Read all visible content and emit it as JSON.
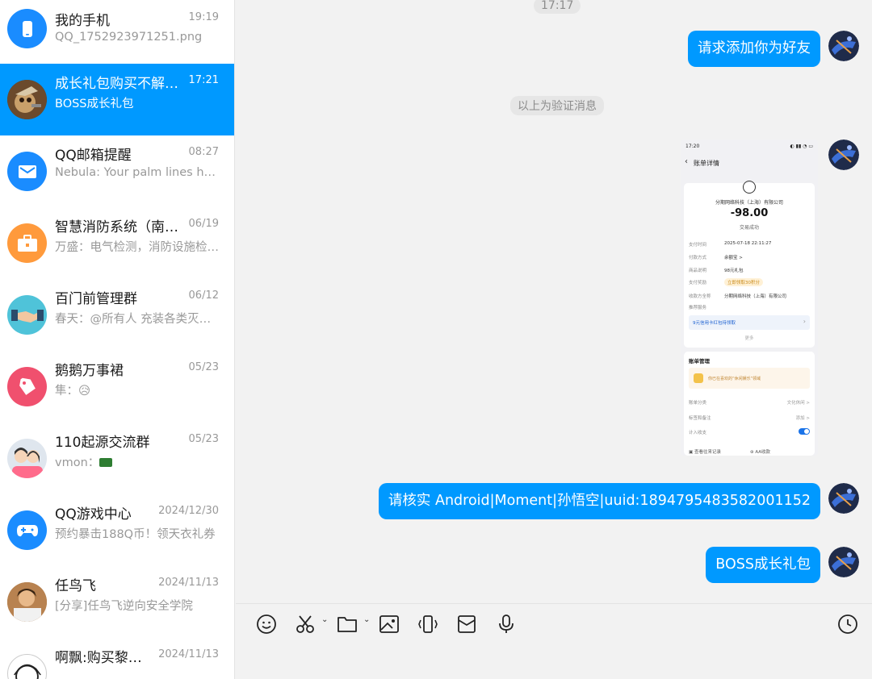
{
  "conversations": [
    {
      "name": "我的手机",
      "time": "19:19",
      "preview": "QQ_1752923971251.png",
      "icon": "phone-icon",
      "active": false
    },
    {
      "name": "成长礼包购买不解…",
      "time": "17:21",
      "preview": "BOSS成长礼包",
      "icon": "cartoon-avatar",
      "active": true
    },
    {
      "name": "QQ邮箱提醒",
      "time": "08:27",
      "preview": "Nebula: Your palm lines ha…",
      "icon": "mail-icon",
      "active": false
    },
    {
      "name": "智慧消防系统（南…",
      "time": "06/19",
      "preview": "万盛：电气检测，消防设施检…",
      "icon": "briefcase-icon",
      "active": false
    },
    {
      "name": "百门前管理群",
      "time": "06/12",
      "preview": "春天：@所有人 充装各类灭…",
      "icon": "handshake-icon",
      "active": false
    },
    {
      "name": "鹅鹅万事裙",
      "time": "05/23",
      "preview": "隼：😥",
      "icon": "tag-icon",
      "active": false
    },
    {
      "name": "110起源交流群",
      "time": "05/23",
      "preview": "vmon：",
      "icon": "group-people-icon",
      "active": false
    },
    {
      "name": "QQ游戏中心",
      "time": "2024/12/30",
      "preview": "预约暴击188Q币！领天衣礼券",
      "icon": "gamepad-icon",
      "active": false
    },
    {
      "name": "任鸟飞",
      "time": "2024/11/13",
      "preview": "[分享]任鸟飞逆向安全学院",
      "icon": "person-avatar",
      "active": false
    },
    {
      "name": "啊飘:购买黎…",
      "time": "2024/11/13",
      "preview": "",
      "icon": "anime-avatar",
      "active": false
    }
  ],
  "chat": {
    "top_time": "17:17",
    "messages": {
      "m1": "请求添加你为好友",
      "verify_notice": "以上为验证消息",
      "m3": "请核实 Android|Moment|孙悟空|uuid:1894795483582001152",
      "m4": "BOSS成长礼包"
    },
    "screenshot": {
      "status_time": "17:20",
      "page_title": "账单详情",
      "merchant": "分期网络科技（上海）有限公司",
      "amount": "-98.00",
      "status": "交易成功",
      "rows": [
        {
          "k": "支付时间",
          "v": "2025-07-18 22:11:27"
        },
        {
          "k": "付款方式",
          "v": "余额宝 >"
        },
        {
          "k": "商品说明",
          "v": "98元礼包"
        },
        {
          "k": "支付奖励",
          "v": "立即领取30积分"
        },
        {
          "k": "收款方全称",
          "v": "分期网络科技（上海）有限公司"
        },
        {
          "k": "推荐服务",
          "v": ""
        }
      ],
      "promo": "9元信用卡红包待领取",
      "more": "更多",
      "section": "账单管理",
      "tip": "你已在喜欢的“休闲娱乐”领域",
      "category_k": "账单分类",
      "category_v": "文化休闲 >",
      "tag_k": "标签和备注",
      "tag_v": "添加 >",
      "count_k": "计入收支",
      "footer_left": "查看往来记录",
      "footer_right": "AA收款"
    }
  },
  "colors": {
    "accent": "#0099ff",
    "bg": "#f2f2f2"
  }
}
